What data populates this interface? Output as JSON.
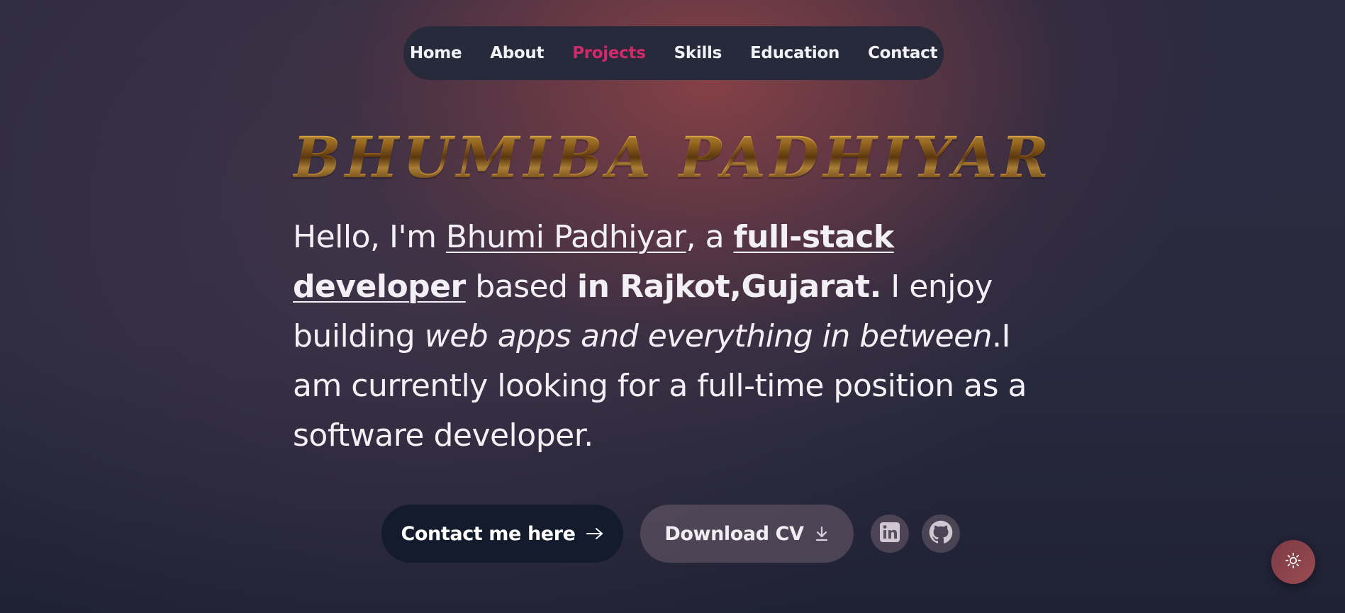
{
  "nav": {
    "items": [
      {
        "label": "Home",
        "active": false
      },
      {
        "label": "About",
        "active": false
      },
      {
        "label": "Projects",
        "active": true
      },
      {
        "label": "Skills",
        "active": false
      },
      {
        "label": "Education",
        "active": false
      },
      {
        "label": "Contact",
        "active": false
      }
    ],
    "active_color": "#cf2a6a"
  },
  "hero": {
    "title": "BHUMIBA PADHIYAR",
    "intro": {
      "p1": "Hello, I'm ",
      "name": "Bhumi Padhiyar",
      "p2": ", a ",
      "role": "full-stack developer",
      "p3": " based ",
      "location": "in Rajkot,Gujarat.",
      "p4": " I enjoy building ",
      "interest": "web apps and everything in between",
      "p5": ".I am currently looking for a full-time position as a software developer."
    }
  },
  "actions": {
    "contact_label": "Contact me here",
    "cv_label": "Download CV",
    "contact_icon": "arrow-right-icon",
    "cv_icon": "download-icon"
  },
  "social": {
    "linkedin_icon": "linkedin-icon",
    "github_icon": "github-icon"
  },
  "theme_toggle": {
    "icon": "sun-icon"
  },
  "colors": {
    "button_dark": "#131b2c",
    "nav_bg": "#272a3b",
    "title_gold": "#c98a2a"
  }
}
